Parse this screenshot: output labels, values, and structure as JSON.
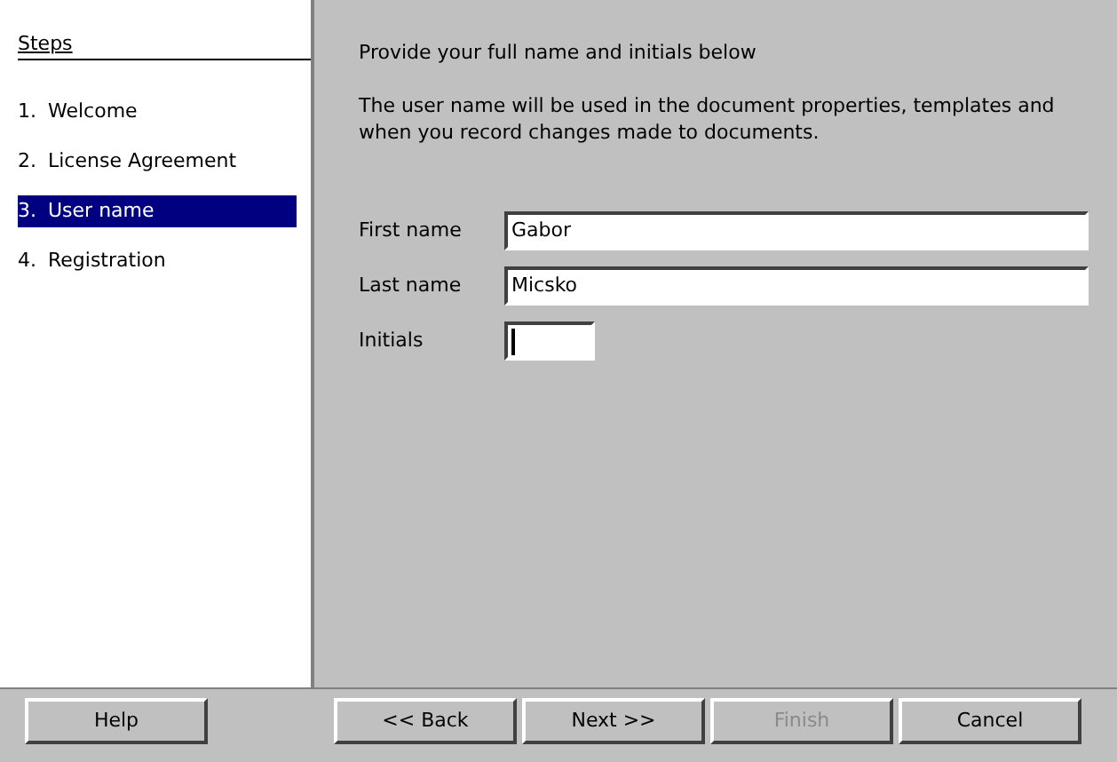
{
  "steps": {
    "title": "Steps",
    "items": [
      {
        "number": "1.",
        "label": "Welcome",
        "selected": false
      },
      {
        "number": "2.",
        "label": "License Agreement",
        "selected": false
      },
      {
        "number": "3.",
        "label": "User name",
        "selected": true
      },
      {
        "number": "4.",
        "label": "Registration",
        "selected": false
      }
    ]
  },
  "content": {
    "heading": "Provide your full name and initials below",
    "description": "The user name will be used in the document properties, templates and when you record changes made to documents.",
    "fields": [
      {
        "label": "First name",
        "value": "Gabor",
        "kind": "wide",
        "focused": false
      },
      {
        "label": "Last name",
        "value": "Micsko",
        "kind": "wide",
        "focused": false
      },
      {
        "label": "Initials",
        "kind": "short",
        "focused": true
      }
    ]
  },
  "help_buttons": [
    {
      "label": "Help",
      "disabled": false
    }
  ],
  "nav_buttons": [
    {
      "label": "<< Back",
      "disabled": false
    },
    {
      "label": "Next >>",
      "disabled": false
    },
    {
      "label": "Finish",
      "disabled": true
    },
    {
      "label": "Cancel",
      "disabled": false
    }
  ]
}
